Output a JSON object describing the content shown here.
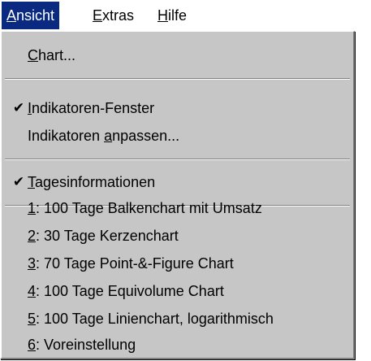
{
  "menubar": {
    "items": [
      {
        "mnemonic": "A",
        "rest": "nsicht"
      },
      {
        "mnemonic": "E",
        "rest": "xtras"
      },
      {
        "mnemonic": "H",
        "rest": "ilfe"
      }
    ]
  },
  "menu": {
    "chart": {
      "mnemonic": "C",
      "rest": "hart..."
    },
    "indikatoren_fenster": {
      "mnemonic": "I",
      "rest": "ndikatoren-Fenster",
      "check": "✔"
    },
    "indikatoren_anpassen": {
      "pre": "Indikatoren ",
      "mnemonic": "a",
      "rest": "npassen..."
    },
    "tagesinformationen": {
      "mnemonic": "T",
      "rest": "agesinformationen",
      "check": "✔"
    },
    "presets": [
      {
        "mnemonic": "1",
        "rest": ": 100 Tage Balkenchart mit Umsatz"
      },
      {
        "mnemonic": "2",
        "rest": ": 30 Tage Kerzenchart"
      },
      {
        "mnemonic": "3",
        "rest": ": 70 Tage Point-&-Figure Chart"
      },
      {
        "mnemonic": "4",
        "rest": ": 100 Tage Equivolume Chart"
      },
      {
        "mnemonic": "5",
        "rest": ": 100 Tage Linienchart, logarithmisch"
      },
      {
        "mnemonic": "6",
        "rest": ": Voreinstellung"
      }
    ]
  },
  "colors": {
    "menu_background": "#c6c6c6",
    "highlight": "#0a2a82",
    "highlight_text": "#ffffff"
  }
}
